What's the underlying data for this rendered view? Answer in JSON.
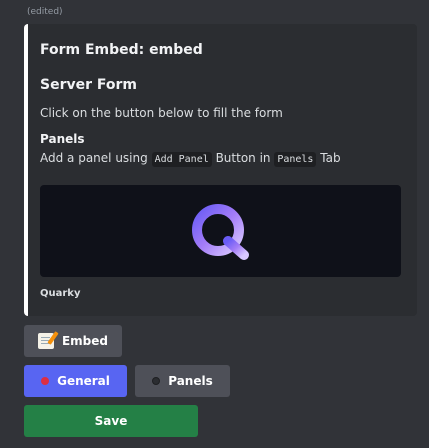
{
  "message": {
    "edited_label": "(edited)"
  },
  "embed": {
    "title": "Form Embed: embed",
    "field_title": "Server Form",
    "field_description": "Click on the button below to fill the form",
    "panels_title": "Panels",
    "panels_desc_prefix": "Add a panel using ",
    "panels_desc_code1": "Add Panel",
    "panels_desc_middle": " Button in ",
    "panels_desc_code2": "Panels",
    "panels_desc_suffix": " Tab",
    "footer": "Quarky",
    "accent_color": "#ffffff"
  },
  "buttons": {
    "embed_label": "Embed",
    "general_label": "General",
    "panels_label": "Panels",
    "save_label": "Save"
  },
  "colors": {
    "primary": "#5865f2",
    "secondary": "#4e5058",
    "success": "#248046",
    "background": "#313338",
    "embed_bg": "#2b2d31"
  },
  "icons": {
    "embed_button": "memo-icon",
    "general_button": "red-circle-icon",
    "panels_button": "black-circle-icon",
    "image": "quarky-q-logo"
  }
}
